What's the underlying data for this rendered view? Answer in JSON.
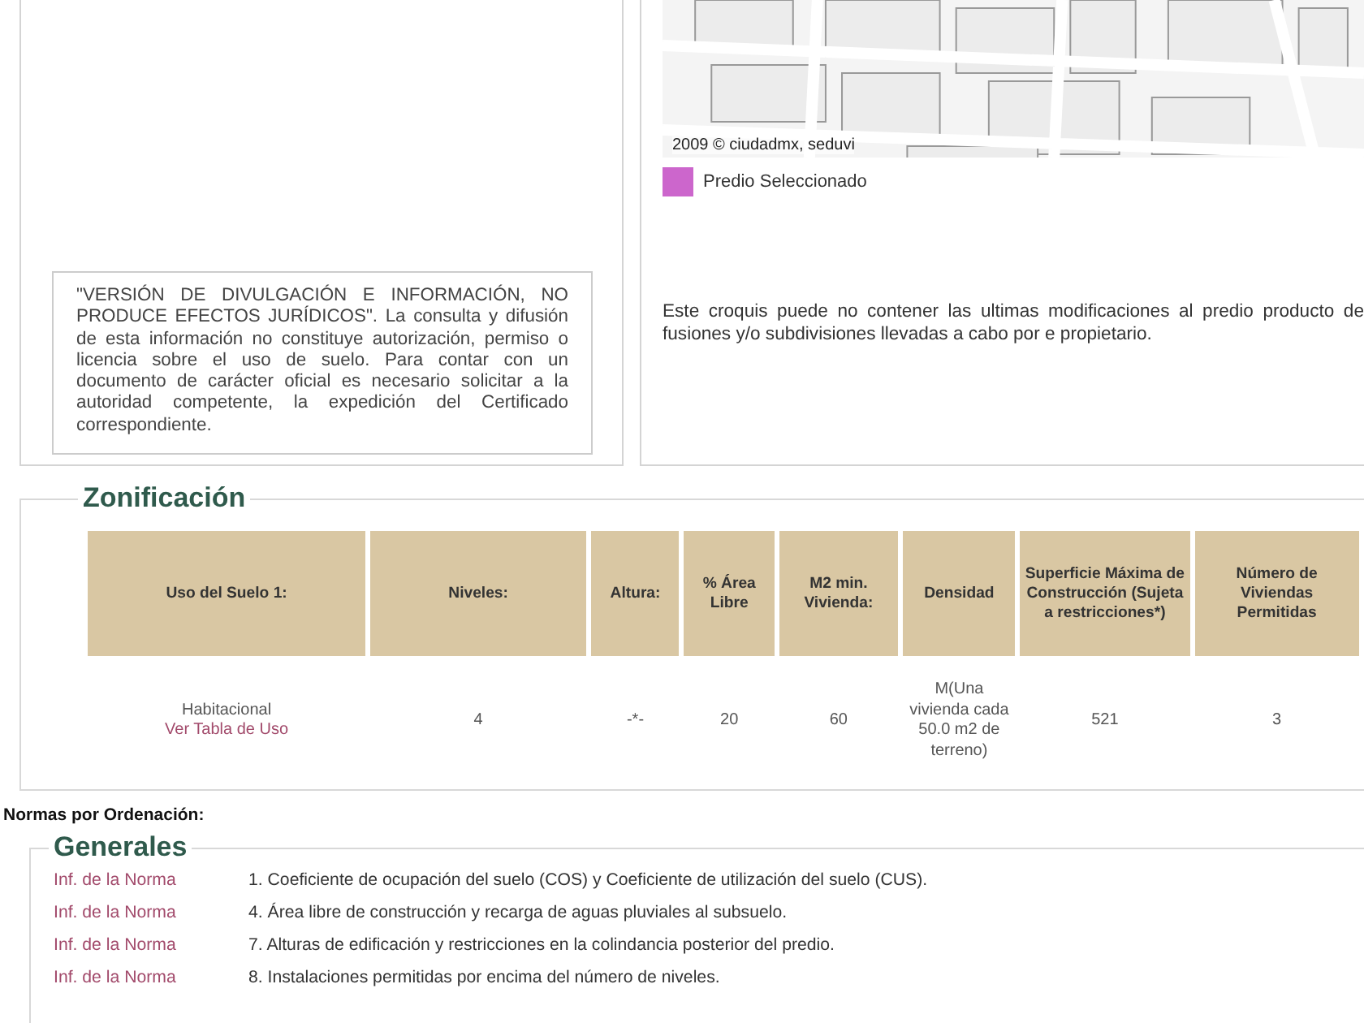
{
  "disclaimer": {
    "text": "\"VERSIÓN DE DIVULGACIÓN E INFORMACIÓN, NO PRODUCE EFECTOS JURÍDICOS\". La consulta y difusión de esta información no constituye autorización, permiso o licencia sobre el uso de suelo. Para contar con un documento de carácter oficial es necesario solicitar a la autoridad competente, la expedición del Certificado correspondiente."
  },
  "map": {
    "attribution": "2009 © ciudadmx, seduvi",
    "legend": [
      {
        "label": "Predio Seleccionado",
        "color": "#cc66cc"
      }
    ],
    "note": "Este croquis puede no contener las ultimas modificaciones al predio producto de fusiones y/o subdivisiones llevadas a cabo por e propietario."
  },
  "zonificacion": {
    "title": "Zonificación",
    "columns": [
      "Uso del Suelo 1:",
      "Niveles:",
      "Altura:",
      "% Área Libre",
      "M2 min. Vivienda:",
      "Densidad",
      "Superficie Máxima de Construcción (Sujeta a restricciones*)",
      "Número de Viviendas Permitidas"
    ],
    "rows": [
      {
        "link": "Ver Tabla de Uso",
        "cells": [
          "Habitacional",
          "4",
          "-*-",
          "20",
          "60",
          "M(Una vivienda cada 50.0 m2 de terreno)",
          "521",
          "3"
        ]
      }
    ]
  },
  "normas_heading": "Normas por Ordenación:",
  "generales": {
    "title": "Generales",
    "items": [
      {
        "link": "Inf. de la Norma",
        "text": "1. Coeficiente de ocupación del suelo (COS) y Coeficiente de utilización del suelo (CUS)."
      },
      {
        "link": "Inf. de la Norma",
        "text": "4. Área libre de construcción y recarga de aguas pluviales al subsuelo."
      },
      {
        "link": "Inf. de la Norma",
        "text": "7. Alturas de edificación y restricciones en la colindancia posterior del predio."
      },
      {
        "link": "Inf. de la Norma",
        "text": "8. Instalaciones permitidas por encima del número de niveles."
      }
    ]
  }
}
